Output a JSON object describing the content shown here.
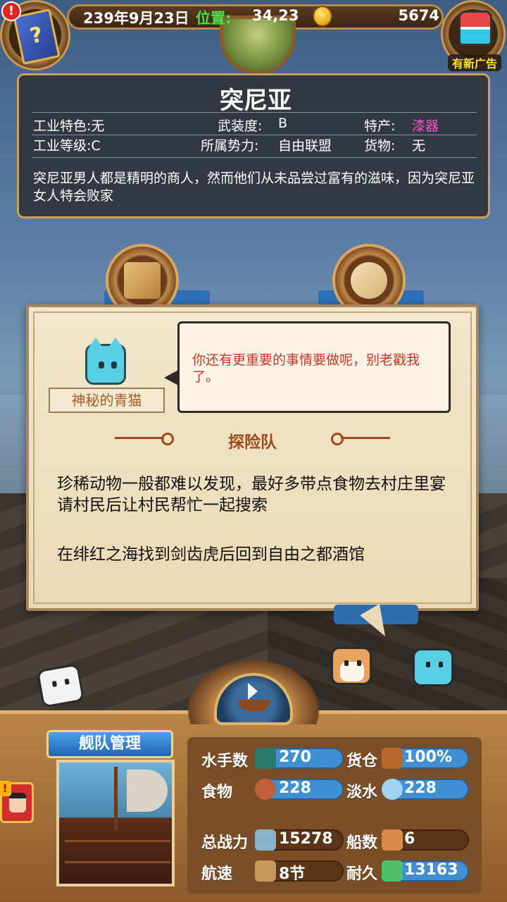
{
  "status_bar": {
    "date": "239年9月23日",
    "position_label": "位置:",
    "position_value": "34,23",
    "gold": "5674",
    "alert_symbol": "!",
    "ad_label": "有新广告",
    "book_symbol": "?"
  },
  "city": {
    "name": "突尼亚",
    "industry_feature_label": "工业特色:",
    "industry_feature_value": "无",
    "armament_label": "武装度:",
    "armament_value": "B",
    "specialty_label": "特产:",
    "specialty_value": "漆器",
    "industry_level_label": "工业等级:",
    "industry_level_value": "C",
    "faction_label": "所属势力:",
    "faction_value": "自由联盟",
    "goods_label": "货物:",
    "goods_value": "无",
    "description": "突尼亚男人都是精明的商人，然而他们从未品尝过富有的滋味，因为突尼亚女人特会败家",
    "colors": {
      "specialty": "#ff54d0"
    }
  },
  "dialog": {
    "speaker": "神秘的青猫",
    "speech": "你还有更重要的事情要做呢，别老戳我了。",
    "mission_title": "探险队",
    "mission_text_1": "珍稀动物一般都难以发现，最好多带点食物去村庄里宴请村民后让村民帮忙一起搜索",
    "mission_text_2": "在绯红之海找到剑齿虎后回到自由之都酒馆",
    "colors": {
      "speech": "#c2362e",
      "title": "#9b4a1c"
    }
  },
  "fleet": {
    "title": "舰队管理",
    "stats": [
      {
        "label": "水手数",
        "icon": "sailor-icon",
        "value": "270"
      },
      {
        "label": "货仓",
        "icon": "cargo-crate-icon",
        "value": "100%"
      },
      {
        "label": "食物",
        "icon": "meat-icon",
        "value": "228"
      },
      {
        "label": "淡水",
        "icon": "water-jug-icon",
        "value": "228"
      },
      {
        "label": "总战力",
        "icon": "crossed-swords-icon",
        "value": "15278"
      },
      {
        "label": "船数",
        "icon": "ship-count-icon",
        "value": "6"
      },
      {
        "label": "航速",
        "icon": "sailboat-speed-icon",
        "value": "8节"
      },
      {
        "label": "耐久",
        "icon": "anchor-durability-icon",
        "value": "13163"
      }
    ]
  }
}
